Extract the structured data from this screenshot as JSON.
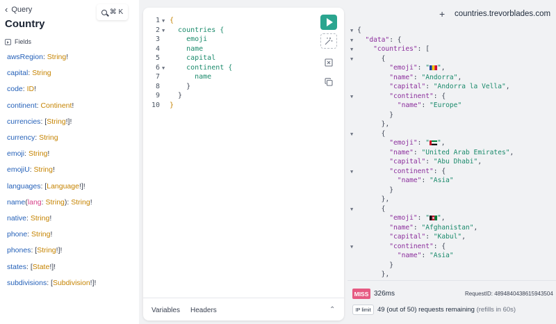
{
  "docs": {
    "back_label": "Query",
    "title": "Country",
    "fields_heading": "Fields",
    "search_shortcut": "⌘ K",
    "fields": [
      {
        "name": "awsRegion",
        "type": "String",
        "suffix": "!"
      },
      {
        "name": "capital",
        "type": "String",
        "suffix": ""
      },
      {
        "name": "code",
        "type": "ID",
        "suffix": "!"
      },
      {
        "name": "continent",
        "type": "Continent",
        "suffix": "!"
      },
      {
        "name": "currencies",
        "type": "String",
        "prefix": "[",
        "suffix": "!]!"
      },
      {
        "name": "currency",
        "type": "String",
        "suffix": ""
      },
      {
        "name": "emoji",
        "type": "String",
        "suffix": "!"
      },
      {
        "name": "emojiU",
        "type": "String",
        "suffix": "!"
      },
      {
        "name": "languages",
        "type": "Language",
        "prefix": "[",
        "suffix": "!]!"
      },
      {
        "name": "name",
        "arg_name": "lang",
        "arg_type": "String",
        "type": "String",
        "suffix": "!"
      },
      {
        "name": "native",
        "type": "String",
        "suffix": "!"
      },
      {
        "name": "phone",
        "type": "String",
        "suffix": "!"
      },
      {
        "name": "phones",
        "type": "String",
        "prefix": "[",
        "suffix": "!]!"
      },
      {
        "name": "states",
        "type": "State",
        "prefix": "[",
        "suffix": "!]!"
      },
      {
        "name": "subdivisions",
        "type": "Subdivision",
        "prefix": "[",
        "suffix": "!]!"
      }
    ]
  },
  "editor": {
    "lines": [
      {
        "n": "1",
        "fold": true,
        "indent": "",
        "text": "{",
        "cls": "brace-y"
      },
      {
        "n": "2",
        "fold": true,
        "indent": "  ",
        "text": "countries {",
        "cls": "ctext"
      },
      {
        "n": "3",
        "fold": false,
        "indent": "    ",
        "text": "emoji",
        "cls": "ctext"
      },
      {
        "n": "4",
        "fold": false,
        "indent": "    ",
        "text": "name",
        "cls": "ctext"
      },
      {
        "n": "5",
        "fold": false,
        "indent": "    ",
        "text": "capital",
        "cls": "ctext"
      },
      {
        "n": "6",
        "fold": true,
        "indent": "    ",
        "text": "continent {",
        "cls": "ctext"
      },
      {
        "n": "7",
        "fold": false,
        "indent": "      ",
        "text": "name",
        "cls": "ctext"
      },
      {
        "n": "8",
        "fold": false,
        "indent": "    ",
        "text": "}",
        "cls": "brace-n"
      },
      {
        "n": "9",
        "fold": false,
        "indent": "  ",
        "text": "}",
        "cls": "brace-n"
      },
      {
        "n": "10",
        "fold": false,
        "indent": "",
        "text": "}",
        "cls": "brace-y"
      }
    ],
    "tabs": {
      "variables": "Variables",
      "headers": "Headers"
    }
  },
  "header": {
    "host": "countries.trevorblades.com",
    "plus": "+"
  },
  "response": {
    "countries": [
      {
        "flag": "andorra",
        "name": "Andorra",
        "capital": "Andorra la Vella",
        "continent": "Europe"
      },
      {
        "flag": "uae",
        "name": "United Arab Emirates",
        "capital": "Abu Dhabi",
        "continent": "Asia"
      },
      {
        "flag": "afghanistan",
        "name": "Afghanistan",
        "capital": "Kabul",
        "continent": "Asia"
      }
    ]
  },
  "footer": {
    "cache_status": "MISS",
    "duration": "326ms",
    "request_id": "RequestID: 4894840438615943504",
    "ip_limit_label": "IP limit",
    "remaining": "49 (out of 50) requests remaining",
    "refill": "(refills in 60s)"
  },
  "colors": {
    "accent": "#2aa58f",
    "miss_badge": "#e65a82",
    "field_name": "#2460b8",
    "field_type": "#c58300",
    "json_key": "#8b2e9c",
    "json_string": "#1a8a6b"
  }
}
